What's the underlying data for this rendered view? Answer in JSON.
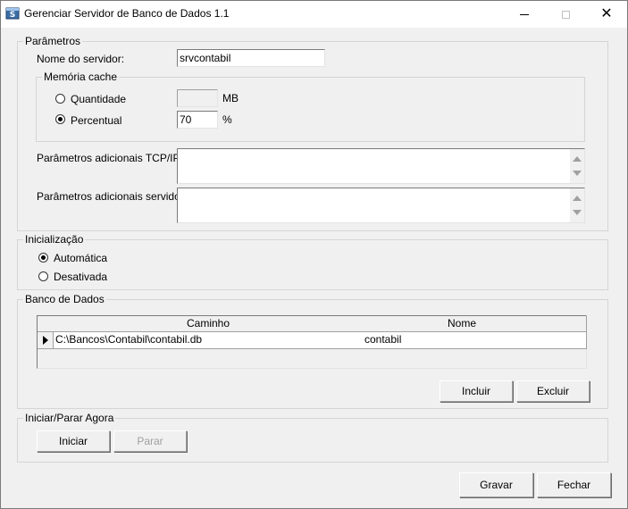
{
  "window": {
    "title": "Gerenciar Servidor de Banco de Dados 1.1",
    "close_glyph": "✕"
  },
  "parametros": {
    "title": "Parâmetros",
    "server_name_label": "Nome do servidor:",
    "server_name_value": "srvcontabil",
    "cache": {
      "title": "Memória cache",
      "quantidade_label": "Quantidade",
      "quantidade_value": "",
      "quantidade_unit": "MB",
      "percentual_label": "Percentual",
      "percentual_value": "70",
      "percentual_unit": "%",
      "selected": "percentual"
    },
    "tcpip_label": "Parâmetros adicionais TCP/IP:",
    "tcpip_value": "",
    "servidor_label": "Parâmetros adicionais servidor:",
    "servidor_value": ""
  },
  "inicializacao": {
    "title": "Inicialização",
    "automatica_label": "Automática",
    "desativada_label": "Desativada",
    "selected": "automatica"
  },
  "banco": {
    "title": "Banco de Dados",
    "columns": [
      "Caminho",
      "Nome"
    ],
    "rows": [
      {
        "caminho": "C:\\Bancos\\Contabil\\contabil.db",
        "nome": "contabil"
      }
    ],
    "incluir_label": "Incluir",
    "excluir_label": "Excluir"
  },
  "iniciar": {
    "title": "Iniciar/Parar Agora",
    "iniciar_label": "Iniciar",
    "parar_label": "Parar"
  },
  "footer": {
    "gravar_label": "Gravar",
    "fechar_label": "Fechar"
  },
  "icons": {
    "app": "database-server-icon",
    "minimize": "minimize-icon",
    "maximize": "maximize-icon",
    "close": "close-icon"
  }
}
